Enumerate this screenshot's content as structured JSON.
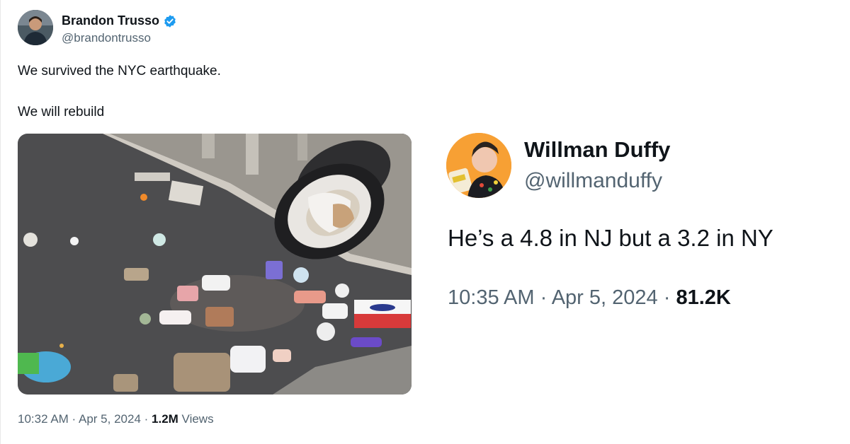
{
  "left_tweet": {
    "display_name": "Brandon Trusso",
    "handle": "@brandontrusso",
    "text_line1": "We survived the NYC earthquake.",
    "text_line2": "We will rebuild",
    "time": "10:32 AM",
    "date": "Apr 5, 2024",
    "views_count": "1.2M",
    "views_label": "Views",
    "separator": " · ",
    "photo_icon": "overturned-trash-can-photo"
  },
  "right_tweet": {
    "display_name": "Willman Duffy",
    "handle": "@willmanduffy",
    "text": "He’s a 4.8 in NJ but a 3.2 in NY",
    "time": "10:35 AM",
    "date": "Apr 5, 2024",
    "views_count": "81.2K",
    "separator": " · "
  },
  "colors": {
    "verified_blue": "#1d9bf0",
    "secondary_text": "#536471",
    "primary_text": "#0f1419",
    "avatar_orange": "#f7a034"
  }
}
